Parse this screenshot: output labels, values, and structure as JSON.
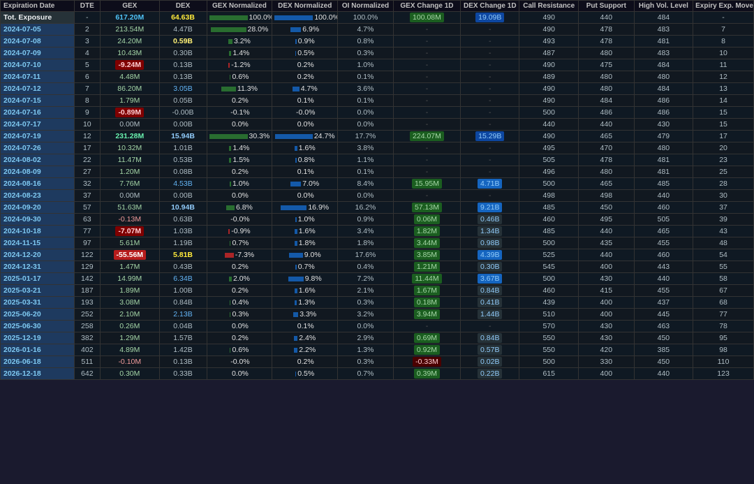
{
  "columns": [
    "Expiration Date",
    "DTE",
    "GEX",
    "DEX",
    "GEX Normalized",
    "DEX Normalized",
    "OI Normalized",
    "GEX Change 1D",
    "DEX Change 1D",
    "Call Resistance",
    "Put Support",
    "High Vol. Level",
    "Expiry Exp. Move"
  ],
  "rows": [
    {
      "date": "Tot. Exposure",
      "dte": "-",
      "gex": "617.20M",
      "dex": "64.63B",
      "gex_norm": "100.0%",
      "dex_norm": "100.0%",
      "oi_norm": "100.0%",
      "gex_chg": "100.08M",
      "dex_chg": "19.09B",
      "call_res": "490",
      "put_sup": "440",
      "high_vol": "484",
      "expiry": "-",
      "gex_type": "tot",
      "dex_type": "tot"
    },
    {
      "date": "2024-07-05",
      "dte": "2",
      "gex": "213.54M",
      "dex": "4.47B",
      "gex_norm": "28.0%",
      "dex_norm": "6.9%",
      "oi_norm": "4.7%",
      "gex_chg": "-",
      "dex_chg": "-",
      "call_res": "490",
      "put_sup": "478",
      "high_vol": "483",
      "expiry": "7",
      "gex_type": "pos",
      "dex_type": "normal"
    },
    {
      "date": "2024-07-08",
      "dte": "3",
      "gex": "24.20M",
      "dex": "0.59B",
      "gex_norm": "3.2%",
      "dex_norm": "0.9%",
      "oi_norm": "0.8%",
      "gex_chg": "-",
      "dex_chg": "-",
      "call_res": "493",
      "put_sup": "478",
      "high_vol": "481",
      "expiry": "8",
      "gex_type": "pos",
      "dex_type": "yellow"
    },
    {
      "date": "2024-07-09",
      "dte": "4",
      "gex": "10.43M",
      "dex": "0.30B",
      "gex_norm": "1.4%",
      "dex_norm": "0.5%",
      "oi_norm": "0.3%",
      "gex_chg": "-",
      "dex_chg": "-",
      "call_res": "487",
      "put_sup": "480",
      "high_vol": "483",
      "expiry": "10",
      "gex_type": "pos",
      "dex_type": "normal"
    },
    {
      "date": "2024-07-10",
      "dte": "5",
      "gex": "-9.24M",
      "dex": "0.13B",
      "gex_norm": "-1.2%",
      "dex_norm": "0.2%",
      "oi_norm": "1.0%",
      "gex_chg": "-",
      "dex_chg": "-",
      "call_res": "490",
      "put_sup": "475",
      "high_vol": "484",
      "expiry": "11",
      "gex_type": "neg",
      "dex_type": "normal"
    },
    {
      "date": "2024-07-11",
      "dte": "6",
      "gex": "4.48M",
      "dex": "0.13B",
      "gex_norm": "0.6%",
      "dex_norm": "0.2%",
      "oi_norm": "0.1%",
      "gex_chg": "-",
      "dex_chg": "-",
      "call_res": "489",
      "put_sup": "480",
      "high_vol": "480",
      "expiry": "12",
      "gex_type": "pos",
      "dex_type": "normal"
    },
    {
      "date": "2024-07-12",
      "dte": "7",
      "gex": "86.20M",
      "dex": "3.05B",
      "gex_norm": "11.3%",
      "dex_norm": "4.7%",
      "oi_norm": "3.6%",
      "gex_chg": "-",
      "dex_chg": "-",
      "call_res": "490",
      "put_sup": "480",
      "high_vol": "484",
      "expiry": "13",
      "gex_type": "pos",
      "dex_type": "blue"
    },
    {
      "date": "2024-07-15",
      "dte": "8",
      "gex": "1.79M",
      "dex": "0.05B",
      "gex_norm": "0.2%",
      "dex_norm": "0.1%",
      "oi_norm": "0.1%",
      "gex_chg": "-",
      "dex_chg": "-",
      "call_res": "490",
      "put_sup": "484",
      "high_vol": "486",
      "expiry": "14",
      "gex_type": "pos",
      "dex_type": "normal"
    },
    {
      "date": "2024-07-16",
      "dte": "9",
      "gex": "-0.89M",
      "dex": "-0.00B",
      "gex_norm": "-0.1%",
      "dex_norm": "-0.0%",
      "oi_norm": "0.0%",
      "gex_chg": "-",
      "dex_chg": "-",
      "call_res": "500",
      "put_sup": "486",
      "high_vol": "486",
      "expiry": "15",
      "gex_type": "neg",
      "dex_type": "normal"
    },
    {
      "date": "2024-07-17",
      "dte": "10",
      "gex": "0.00M",
      "dex": "0.00B",
      "gex_norm": "0.0%",
      "dex_norm": "0.0%",
      "oi_norm": "0.0%",
      "gex_chg": "-",
      "dex_chg": "-",
      "call_res": "440",
      "put_sup": "440",
      "high_vol": "430",
      "expiry": "15",
      "gex_type": "neutral",
      "dex_type": "normal"
    },
    {
      "date": "2024-07-19",
      "dte": "12",
      "gex": "231.28M",
      "dex": "15.94B",
      "gex_norm": "30.3%",
      "dex_norm": "24.7%",
      "oi_norm": "17.7%",
      "gex_chg": "224.07M",
      "dex_chg": "15.29B",
      "call_res": "490",
      "put_sup": "465",
      "high_vol": "479",
      "expiry": "17",
      "gex_type": "pos_large",
      "dex_type": "blue_large"
    },
    {
      "date": "2024-07-26",
      "dte": "17",
      "gex": "10.32M",
      "dex": "1.01B",
      "gex_norm": "1.4%",
      "dex_norm": "1.6%",
      "oi_norm": "3.8%",
      "gex_chg": "-",
      "dex_chg": "-",
      "call_res": "495",
      "put_sup": "470",
      "high_vol": "480",
      "expiry": "20",
      "gex_type": "pos",
      "dex_type": "normal"
    },
    {
      "date": "2024-08-02",
      "dte": "22",
      "gex": "11.47M",
      "dex": "0.53B",
      "gex_norm": "1.5%",
      "dex_norm": "0.8%",
      "oi_norm": "1.1%",
      "gex_chg": "-",
      "dex_chg": "-",
      "call_res": "505",
      "put_sup": "478",
      "high_vol": "481",
      "expiry": "23",
      "gex_type": "pos",
      "dex_type": "normal"
    },
    {
      "date": "2024-08-09",
      "dte": "27",
      "gex": "1.20M",
      "dex": "0.08B",
      "gex_norm": "0.2%",
      "dex_norm": "0.1%",
      "oi_norm": "0.1%",
      "gex_chg": "-",
      "dex_chg": "-",
      "call_res": "496",
      "put_sup": "480",
      "high_vol": "481",
      "expiry": "25",
      "gex_type": "pos",
      "dex_type": "normal"
    },
    {
      "date": "2024-08-16",
      "dte": "32",
      "gex": "7.76M",
      "dex": "4.53B",
      "gex_norm": "1.0%",
      "dex_norm": "7.0%",
      "oi_norm": "8.4%",
      "gex_chg": "15.95M",
      "dex_chg": "4.71B",
      "call_res": "500",
      "put_sup": "465",
      "high_vol": "485",
      "expiry": "28",
      "gex_type": "pos",
      "dex_type": "blue"
    },
    {
      "date": "2024-08-23",
      "dte": "37",
      "gex": "0.00M",
      "dex": "0.00B",
      "gex_norm": "0.0%",
      "dex_norm": "0.0%",
      "oi_norm": "0.0%",
      "gex_chg": "-",
      "dex_chg": "-",
      "call_res": "498",
      "put_sup": "498",
      "high_vol": "440",
      "expiry": "30",
      "gex_type": "neutral",
      "dex_type": "normal"
    },
    {
      "date": "2024-09-20",
      "dte": "57",
      "gex": "51.63M",
      "dex": "10.94B",
      "gex_norm": "6.8%",
      "dex_norm": "16.9%",
      "oi_norm": "16.2%",
      "gex_chg": "57.13M",
      "dex_chg": "9.21B",
      "call_res": "485",
      "put_sup": "450",
      "high_vol": "460",
      "expiry": "37",
      "gex_type": "pos",
      "dex_type": "blue_large"
    },
    {
      "date": "2024-09-30",
      "dte": "63",
      "gex": "-0.13M",
      "dex": "0.63B",
      "gex_norm": "-0.0%",
      "dex_norm": "1.0%",
      "oi_norm": "0.9%",
      "gex_chg": "0.06M",
      "dex_chg": "0.46B",
      "call_res": "460",
      "put_sup": "495",
      "high_vol": "505",
      "expiry": "39",
      "gex_type": "neg_tiny",
      "dex_type": "normal"
    },
    {
      "date": "2024-10-18",
      "dte": "77",
      "gex": "-7.07M",
      "dex": "1.03B",
      "gex_norm": "-0.9%",
      "dex_norm": "1.6%",
      "oi_norm": "3.4%",
      "gex_chg": "1.82M",
      "dex_chg": "1.34B",
      "call_res": "485",
      "put_sup": "440",
      "high_vol": "465",
      "expiry": "43",
      "gex_type": "neg",
      "dex_type": "normal"
    },
    {
      "date": "2024-11-15",
      "dte": "97",
      "gex": "5.61M",
      "dex": "1.19B",
      "gex_norm": "0.7%",
      "dex_norm": "1.8%",
      "oi_norm": "1.8%",
      "gex_chg": "3.44M",
      "dex_chg": "0.98B",
      "call_res": "500",
      "put_sup": "435",
      "high_vol": "455",
      "expiry": "48",
      "gex_type": "pos",
      "dex_type": "normal"
    },
    {
      "date": "2024-12-20",
      "dte": "122",
      "gex": "-55.56M",
      "dex": "5.81B",
      "gex_norm": "-7.3%",
      "dex_norm": "9.0%",
      "oi_norm": "17.6%",
      "gex_chg": "3.85M",
      "dex_chg": "4.39B",
      "call_res": "525",
      "put_sup": "440",
      "high_vol": "460",
      "expiry": "54",
      "gex_type": "neg_large",
      "dex_type": "yellow_large"
    },
    {
      "date": "2024-12-31",
      "dte": "129",
      "gex": "1.47M",
      "dex": "0.43B",
      "gex_norm": "0.2%",
      "dex_norm": "0.7%",
      "oi_norm": "0.4%",
      "gex_chg": "1.21M",
      "dex_chg": "0.30B",
      "call_res": "545",
      "put_sup": "400",
      "high_vol": "443",
      "expiry": "55",
      "gex_type": "pos",
      "dex_type": "normal"
    },
    {
      "date": "2025-01-17",
      "dte": "142",
      "gex": "14.99M",
      "dex": "6.34B",
      "gex_norm": "2.0%",
      "dex_norm": "9.8%",
      "oi_norm": "7.2%",
      "gex_chg": "11.44M",
      "dex_chg": "3.67B",
      "call_res": "500",
      "put_sup": "430",
      "high_vol": "440",
      "expiry": "58",
      "gex_type": "pos",
      "dex_type": "blue"
    },
    {
      "date": "2025-03-21",
      "dte": "187",
      "gex": "1.89M",
      "dex": "1.00B",
      "gex_norm": "0.2%",
      "dex_norm": "1.6%",
      "oi_norm": "2.1%",
      "gex_chg": "1.67M",
      "dex_chg": "0.84B",
      "call_res": "460",
      "put_sup": "415",
      "high_vol": "455",
      "expiry": "67",
      "gex_type": "pos",
      "dex_type": "normal"
    },
    {
      "date": "2025-03-31",
      "dte": "193",
      "gex": "3.08M",
      "dex": "0.84B",
      "gex_norm": "0.4%",
      "dex_norm": "1.3%",
      "oi_norm": "0.3%",
      "gex_chg": "0.18M",
      "dex_chg": "0.41B",
      "call_res": "439",
      "put_sup": "400",
      "high_vol": "437",
      "expiry": "68",
      "gex_type": "pos",
      "dex_type": "normal"
    },
    {
      "date": "2025-06-20",
      "dte": "252",
      "gex": "2.10M",
      "dex": "2.13B",
      "gex_norm": "0.3%",
      "dex_norm": "3.3%",
      "oi_norm": "3.2%",
      "gex_chg": "3.94M",
      "dex_chg": "1.44B",
      "call_res": "510",
      "put_sup": "400",
      "high_vol": "445",
      "expiry": "77",
      "gex_type": "pos",
      "dex_type": "blue"
    },
    {
      "date": "2025-06-30",
      "dte": "258",
      "gex": "0.26M",
      "dex": "0.04B",
      "gex_norm": "0.0%",
      "dex_norm": "0.1%",
      "oi_norm": "0.0%",
      "gex_chg": "-",
      "dex_chg": "-",
      "call_res": "570",
      "put_sup": "430",
      "high_vol": "463",
      "expiry": "78",
      "gex_type": "pos",
      "dex_type": "normal"
    },
    {
      "date": "2025-12-19",
      "dte": "382",
      "gex": "1.29M",
      "dex": "1.57B",
      "gex_norm": "0.2%",
      "dex_norm": "2.4%",
      "oi_norm": "2.9%",
      "gex_chg": "0.69M",
      "dex_chg": "0.84B",
      "call_res": "550",
      "put_sup": "430",
      "high_vol": "450",
      "expiry": "95",
      "gex_type": "pos",
      "dex_type": "normal"
    },
    {
      "date": "2026-01-16",
      "dte": "402",
      "gex": "4.89M",
      "dex": "1.42B",
      "gex_norm": "0.6%",
      "dex_norm": "2.2%",
      "oi_norm": "1.3%",
      "gex_chg": "0.92M",
      "dex_chg": "0.57B",
      "call_res": "550",
      "put_sup": "420",
      "high_vol": "385",
      "expiry": "98",
      "gex_type": "pos",
      "dex_type": "normal"
    },
    {
      "date": "2026-06-18",
      "dte": "511",
      "gex": "-0.10M",
      "dex": "0.13B",
      "gex_norm": "-0.0%",
      "dex_norm": "0.2%",
      "oi_norm": "0.3%",
      "gex_chg": "-0.33M",
      "dex_chg": "0.02B",
      "call_res": "500",
      "put_sup": "330",
      "high_vol": "450",
      "expiry": "110",
      "gex_type": "neg_tiny",
      "dex_type": "normal"
    },
    {
      "date": "2026-12-18",
      "dte": "642",
      "gex": "0.30M",
      "dex": "0.33B",
      "gex_norm": "0.0%",
      "dex_norm": "0.5%",
      "oi_norm": "0.7%",
      "gex_chg": "0.39M",
      "dex_chg": "0.22B",
      "call_res": "615",
      "put_sup": "400",
      "high_vol": "440",
      "expiry": "123",
      "gex_type": "pos",
      "dex_type": "normal"
    }
  ],
  "colors": {
    "header_bg": "#0d1117",
    "row_alt1": "#0f1923",
    "row_alt2": "#111820",
    "exp_date_bg": "#1e3a5f",
    "exp_date_color": "#7ec8f0",
    "green_pos": "#00e676",
    "red_neg": "#ff4444",
    "blue_dex": "#4fc3f7",
    "yellow_dex": "#ffeb3b"
  }
}
